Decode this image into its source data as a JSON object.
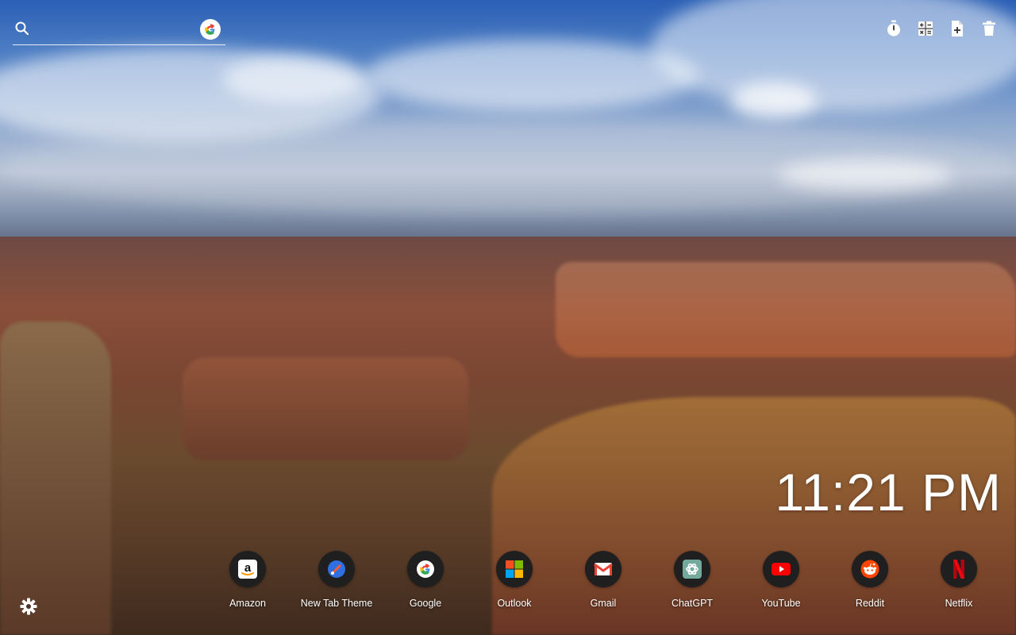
{
  "search": {
    "placeholder": "",
    "icon": "search-icon",
    "engine_icon": "google-icon"
  },
  "toolbar": {
    "buttons": [
      {
        "icon": "stopwatch-icon"
      },
      {
        "icon": "calculator-icon"
      },
      {
        "icon": "file-add-icon"
      },
      {
        "icon": "trash-icon"
      }
    ]
  },
  "clock": {
    "time": "11:21 PM"
  },
  "shortcuts": [
    {
      "label": "Amazon",
      "icon": "amazon-icon"
    },
    {
      "label": "New Tab Theme",
      "icon": "new-tab-theme-icon"
    },
    {
      "label": "Google",
      "icon": "google-icon"
    },
    {
      "label": "Outlook",
      "icon": "outlook-icon"
    },
    {
      "label": "Gmail",
      "icon": "gmail-icon"
    },
    {
      "label": "ChatGPT",
      "icon": "chatgpt-icon"
    },
    {
      "label": "YouTube",
      "icon": "youtube-icon"
    },
    {
      "label": "Reddit",
      "icon": "reddit-icon"
    },
    {
      "label": "Netflix",
      "icon": "netflix-icon"
    }
  ],
  "settings": {
    "icon": "gear-icon"
  },
  "colors": {
    "text": "#ffffff",
    "dock_icon_bg": "#1f1f1f"
  }
}
